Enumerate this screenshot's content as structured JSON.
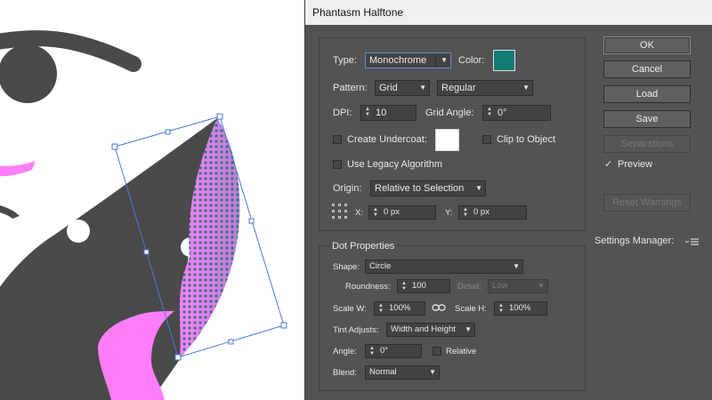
{
  "dialog": {
    "title": "Phantasm Halftone",
    "type": {
      "label": "Type:",
      "value": "Monochrome"
    },
    "color": {
      "label": "Color:",
      "swatch": "#117a73"
    },
    "pattern": {
      "label": "Pattern:",
      "value": "Grid",
      "sub_value": "Regular"
    },
    "dpi": {
      "label": "DPI:",
      "value": "10"
    },
    "grid_angle": {
      "label": "Grid Angle:",
      "value": "0°"
    },
    "create_undercoat": {
      "label": "Create Undercoat:",
      "checked": false,
      "swatch": "#ffffff"
    },
    "clip_to_object": {
      "label": "Clip to Object",
      "checked": false
    },
    "legacy_algorithm": {
      "label": "Use Legacy Algorithm",
      "checked": false
    },
    "origin": {
      "label": "Origin:",
      "value": "Relative to Selection"
    },
    "origin_x": {
      "label": "X:",
      "value": "0 px"
    },
    "origin_y": {
      "label": "Y:",
      "value": "0 px"
    },
    "dot_properties": {
      "title": "Dot Properties",
      "shape": {
        "label": "Shape:",
        "value": "Circle"
      },
      "roundness": {
        "label": "Roundness:",
        "value": "100"
      },
      "detail": {
        "label": "Detail:",
        "value": "Low"
      },
      "scale_w": {
        "label": "Scale W:",
        "value": "100%"
      },
      "scale_h": {
        "label": "Scale H:",
        "value": "100%"
      },
      "tint_adjusts": {
        "label": "Tint Adjusts:",
        "value": "Width and Height"
      },
      "angle": {
        "label": "Angle:",
        "value": "0°"
      },
      "relative": {
        "label": "Relative",
        "checked": false
      },
      "blend": {
        "label": "Blend:",
        "value": "Normal"
      }
    },
    "buttons": {
      "ok": "OK",
      "cancel": "Cancel",
      "load": "Load",
      "save": "Save",
      "separations": "Separations",
      "reset_warnings": "Reset Warnings"
    },
    "preview": {
      "label": "Preview",
      "checked": true,
      "check_glyph": "✓"
    },
    "settings_manager": {
      "label": "Settings Manager:",
      "icon": "menu-lines-icon"
    }
  },
  "artwork": {
    "colors": {
      "dark": "#4a4a4a",
      "pink": "#ff7ef8",
      "halftone": "#137a78",
      "selection": "#4a79d6"
    }
  }
}
